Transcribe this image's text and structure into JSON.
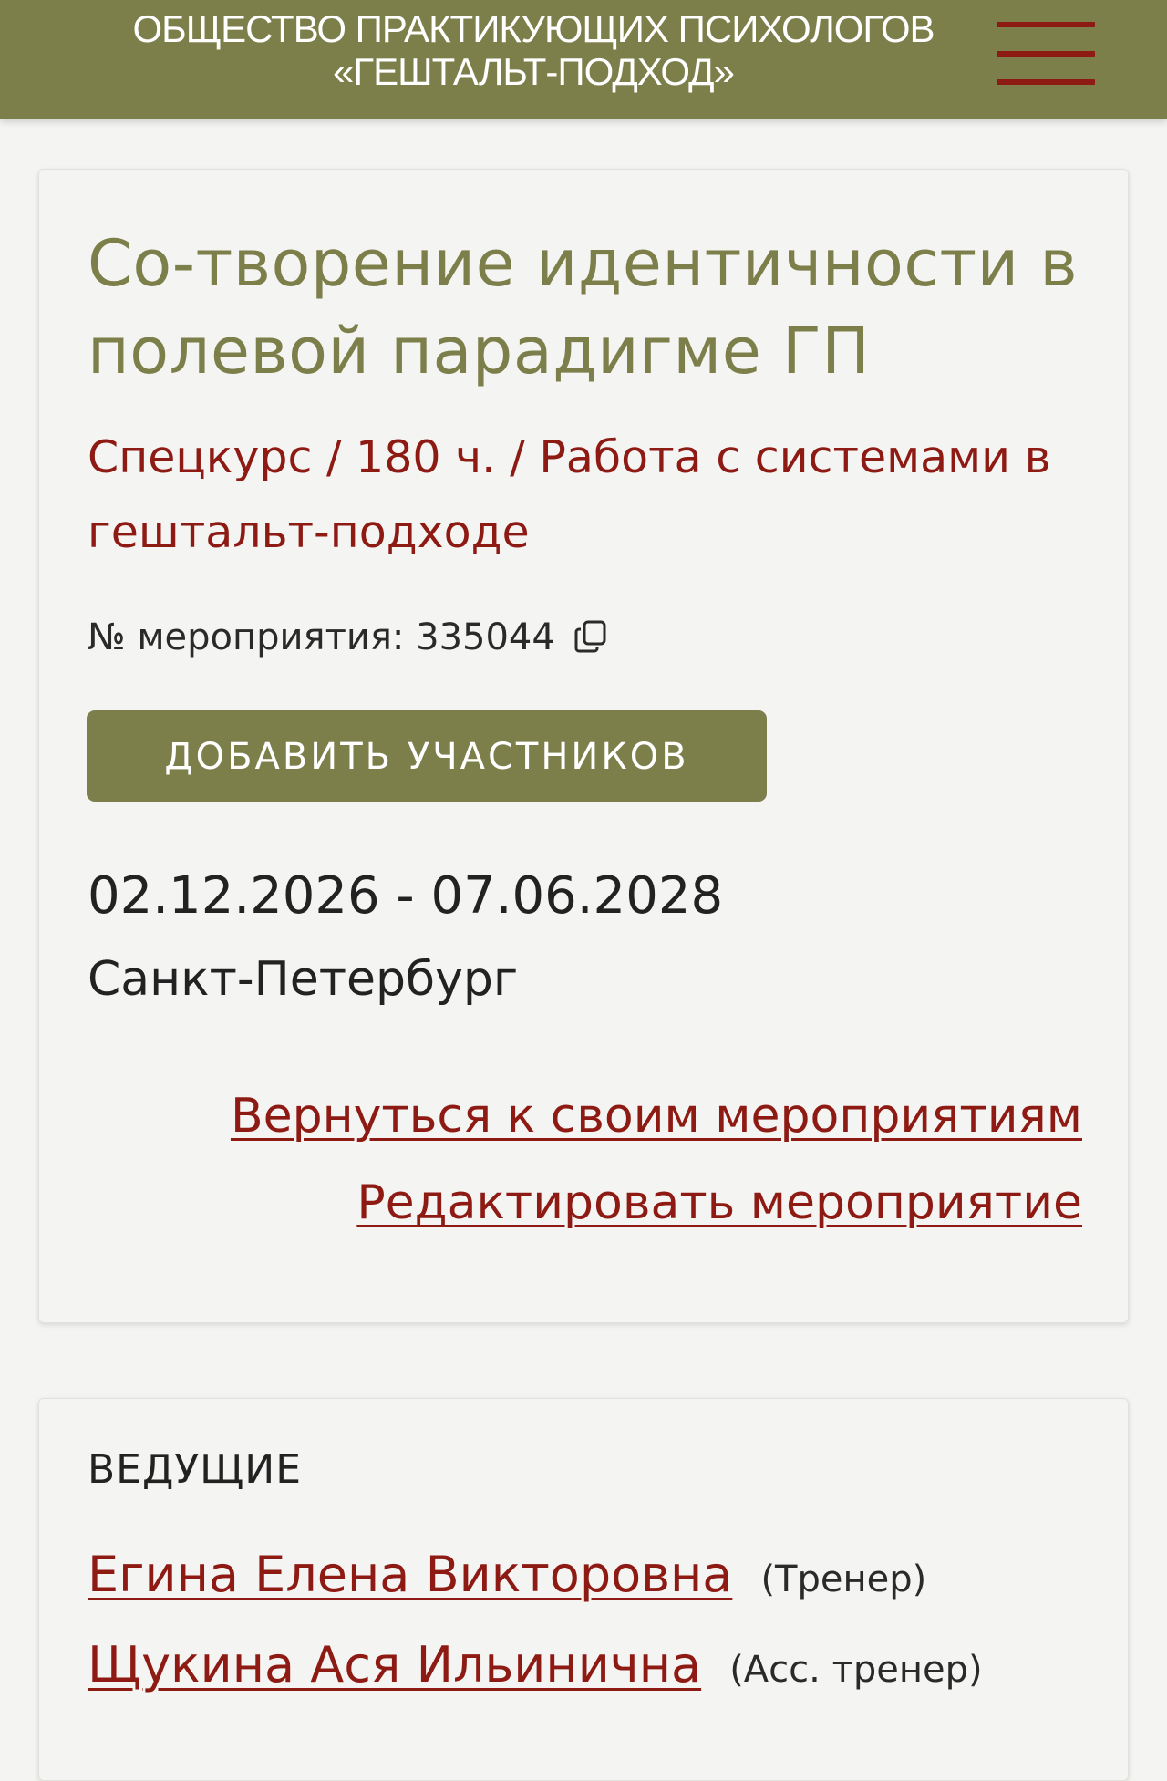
{
  "header": {
    "org_line1": "ОБЩЕСТВО ПРАКТИКУЮЩИХ ПСИХОЛОГОВ",
    "org_line2": "«ГЕШТАЛЬТ-ПОДХОД»",
    "menu_icon": "hamburger-menu-icon",
    "accent_color": "#8e1a14",
    "background_color": "#7d7f4b"
  },
  "event": {
    "title": "Со-творение идентичности в полевой парадигме ГП",
    "subtitle": "Спецкурс / 180 ч. / Работа с системами в гештальт-подходе",
    "number_label": "№ мероприятия:",
    "number_value": "335044",
    "copy_icon": "copy-icon",
    "add_participants_label": "ДОБАВИТЬ УЧАСТНИКОВ",
    "dates": "02.12.2026 - 07.06.2028",
    "city": "Санкт-Петербург",
    "back_link": "Вернуться к своим мероприятиям",
    "edit_link": "Редактировать мероприятие"
  },
  "hosts": {
    "heading": "ВЕДУЩИЕ",
    "items": [
      {
        "name": "Егина Елена Викторовна",
        "role": "(Тренер)"
      },
      {
        "name": "Щукина Ася Ильинична",
        "role": "(Асс. тренер)"
      }
    ]
  }
}
